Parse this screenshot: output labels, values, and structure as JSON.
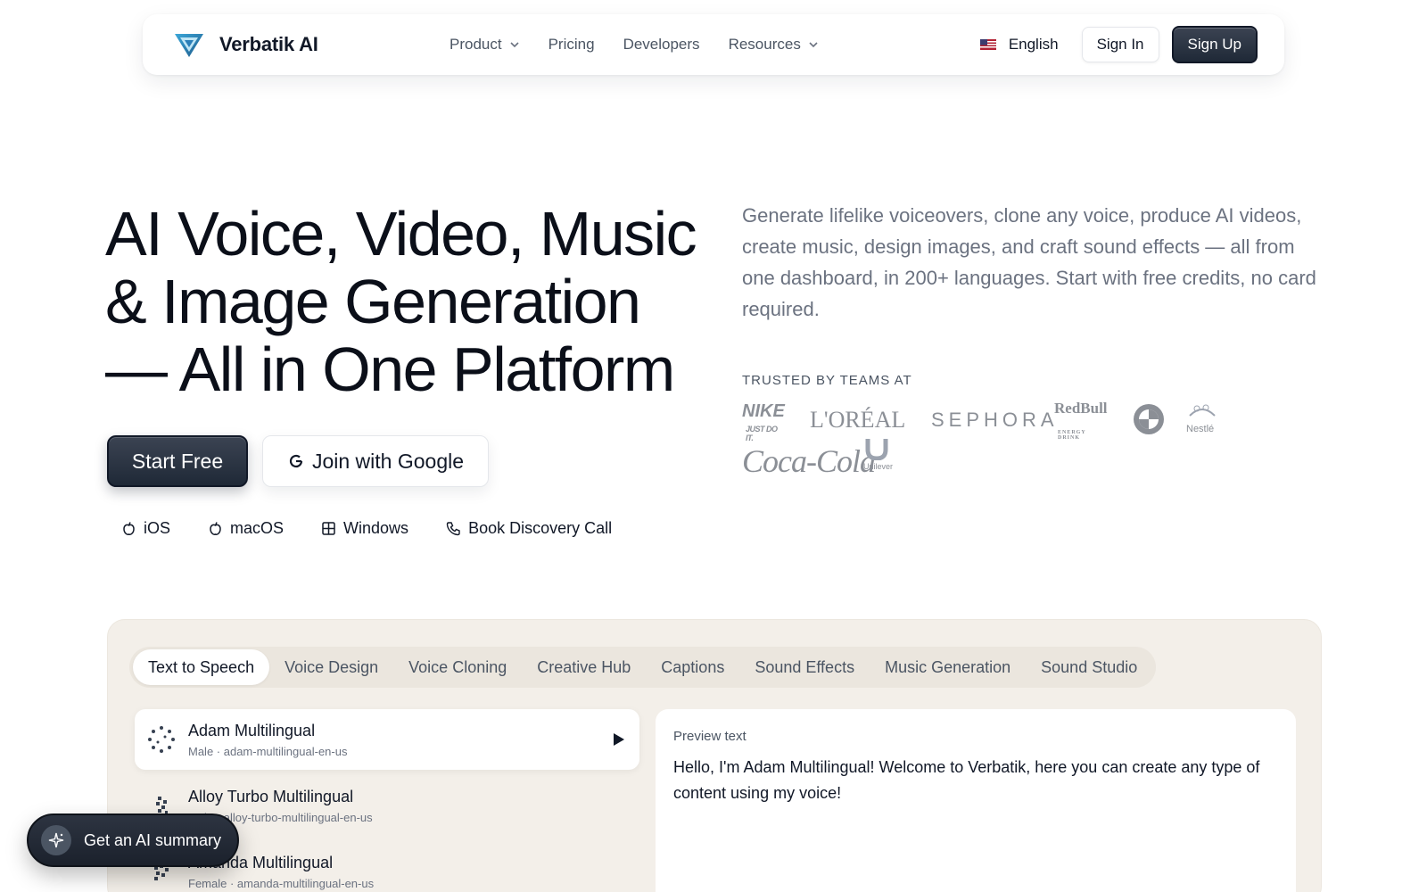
{
  "nav": {
    "brand": "Verbatik AI",
    "links": [
      {
        "label": "Product",
        "dropdown": true
      },
      {
        "label": "Pricing",
        "dropdown": false
      },
      {
        "label": "Developers",
        "dropdown": false
      },
      {
        "label": "Resources",
        "dropdown": true
      }
    ],
    "language": "English",
    "sign_in": "Sign In",
    "sign_up": "Sign Up"
  },
  "hero": {
    "title_lines": [
      "AI Voice, Video, Music",
      "& Image Generation",
      "— All in One Platform"
    ],
    "description": "Generate lifelike voiceovers, clone any voice, produce AI videos, create music, design images, and craft sound effects — all from one dashboard, in 200+ languages. Start with free credits, no card required.",
    "trusted_label": "TRUSTED BY TEAMS AT",
    "logos": {
      "nike": "NIKE",
      "nike_sub": "JUST DO IT.",
      "loreal": "L'ORÉAL",
      "sephora": "SEPHORA",
      "redbull": "RedBull",
      "redbull_sub": "ENERGY DRINK",
      "nestle": "Nestlé",
      "cocacola": "Coca-Cola",
      "unilever": "Unilever"
    },
    "start_button": "Start Free",
    "google_button": "Join with Google",
    "platforms": [
      "iOS",
      "macOS",
      "Windows",
      "Book Discovery Call"
    ]
  },
  "demo": {
    "tabs": [
      "Text to Speech",
      "Voice Design",
      "Voice Cloning",
      "Creative Hub",
      "Captions",
      "Sound Effects",
      "Music Generation",
      "Sound Studio"
    ],
    "active_tab": "Text to Speech",
    "voices": [
      {
        "name": "Adam Multilingual",
        "meta": "Male · adam-multilingual-en-us"
      },
      {
        "name": "Alloy Turbo Multilingual",
        "meta": "Male · alloy-turbo-multilingual-en-us"
      },
      {
        "name": "Amanda Multilingual",
        "meta": "Female · amanda-multilingual-en-us"
      }
    ],
    "preview_label": "Preview text",
    "preview_text": "Hello, I'm Adam Multilingual! Welcome to Verbatik, here you can create any type of content using my voice!"
  },
  "ai_summary": "Get an AI summary",
  "colors": {
    "dark_button": "#1f2937",
    "panel_bg": "#f3efe9",
    "muted_text": "#6b7280"
  }
}
